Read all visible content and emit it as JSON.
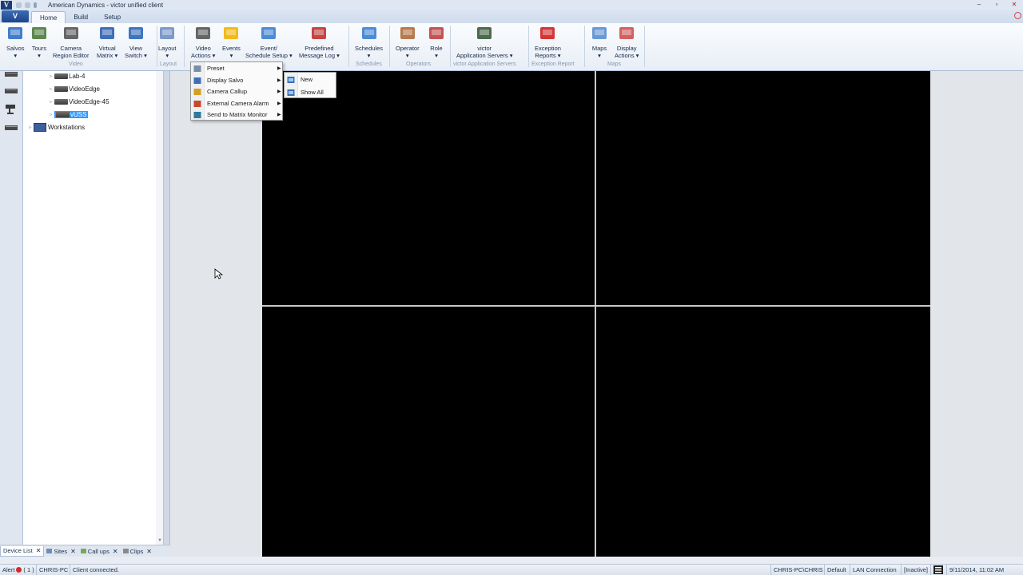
{
  "window": {
    "title": "American Dynamics - victor unified client",
    "logo": "V",
    "controls": [
      "–",
      "▫",
      "✕"
    ]
  },
  "ribbon": {
    "app_menu": "V",
    "tabs": [
      {
        "label": "Home",
        "active": true
      },
      {
        "label": "Build",
        "active": false
      },
      {
        "label": "Setup",
        "active": false
      }
    ],
    "buttons": [
      {
        "id": "salvos",
        "l1": "Salvos",
        "l2": "▾",
        "icon": "salvo-monitor-icon",
        "color": "#2f6fc8"
      },
      {
        "id": "tours",
        "l1": "Tours",
        "l2": "▾",
        "icon": "camera-tour-icon",
        "color": "#4b7a3a"
      },
      {
        "id": "camera-region",
        "l1": "Camera",
        "l2": "Region Editor",
        "icon": "security-camera-icon",
        "color": "#555555"
      },
      {
        "id": "virtual-matrix",
        "l1": "Virtual",
        "l2": "Matrix ▾",
        "icon": "virtual-matrix-icon",
        "color": "#2b5fb0"
      },
      {
        "id": "view-switch",
        "l1": "View",
        "l2": "Switch ▾",
        "icon": "view-switch-icon",
        "color": "#2a66b8"
      },
      {
        "id": "layout",
        "l1": "Layout",
        "l2": "▾",
        "icon": "layout-grid-icon",
        "color": "#6f8fc4"
      },
      {
        "id": "video-actions",
        "l1": "Video",
        "l2": "Actions ▾",
        "icon": "video-clapper-icon",
        "color": "#555555"
      },
      {
        "id": "events",
        "l1": "Events",
        "l2": "▾",
        "icon": "lightning-icon",
        "color": "#f2b400"
      },
      {
        "id": "event-schedule",
        "l1": "Event/",
        "l2": "Schedule Setup ▾",
        "icon": "gear-schedule-icon",
        "color": "#3a7fd1"
      },
      {
        "id": "predefined-message",
        "l1": "Predefined",
        "l2": "Message Log ▾",
        "icon": "message-log-icon",
        "color": "#c03030"
      },
      {
        "id": "schedules",
        "l1": "Schedules",
        "l2": "▾",
        "icon": "calendar-clock-icon",
        "color": "#3a7fd1"
      },
      {
        "id": "operator",
        "l1": "Operator",
        "l2": "▾",
        "icon": "operator-user-icon",
        "color": "#b06a3a"
      },
      {
        "id": "role",
        "l1": "Role",
        "l2": "▾",
        "icon": "role-users-icon",
        "color": "#c04040"
      },
      {
        "id": "app-servers",
        "l1": "victor",
        "l2": "Application Servers ▾",
        "icon": "server-network-icon",
        "color": "#3a5a3a"
      },
      {
        "id": "exception-reports",
        "l1": "Exception",
        "l2": "Reports ▾",
        "icon": "exception-report-icon",
        "color": "#d02020"
      },
      {
        "id": "maps",
        "l1": "Maps",
        "l2": "▾",
        "icon": "map-icon",
        "color": "#5a8fd0"
      },
      {
        "id": "display-actions",
        "l1": "Display",
        "l2": "Actions ▾",
        "icon": "display-actions-icon",
        "color": "#d05050"
      }
    ],
    "groups": [
      "Video",
      "Layout",
      "Schedules",
      "Operators",
      "victor Application Servers",
      "Exception Report",
      "Maps"
    ]
  },
  "device_tree": {
    "nodes": [
      {
        "label": "Lab-4",
        "type": "device"
      },
      {
        "label": "VideoEdge",
        "type": "device"
      },
      {
        "label": "VideoEdge-45",
        "type": "device"
      },
      {
        "label": "vUSS",
        "type": "device",
        "selected": true
      },
      {
        "label": "Workstations",
        "type": "workstation"
      }
    ]
  },
  "video_actions_menu": {
    "items": [
      {
        "label": "Preset",
        "has_submenu": true,
        "icon": "preset-camera-icon"
      },
      {
        "label": "Display Salvo",
        "has_submenu": true,
        "icon": "display-salvo-icon"
      },
      {
        "label": "Camera Callup",
        "has_submenu": true,
        "icon": "camera-callup-icon"
      },
      {
        "label": "External Camera Alarm",
        "has_submenu": true,
        "icon": "camera-alarm-icon"
      },
      {
        "label": "Send to Matrix Monitor",
        "has_submenu": true,
        "icon": "matrix-monitor-icon"
      }
    ],
    "submenu": [
      {
        "label": "New",
        "icon": "salvo-new-icon"
      },
      {
        "label": "Show All",
        "icon": "salvo-show-all-icon"
      }
    ]
  },
  "bottom_tabs": [
    {
      "label": "Device List",
      "active": true
    },
    {
      "label": "Sites",
      "active": false
    },
    {
      "label": "Call ups",
      "active": false
    },
    {
      "label": "Clips",
      "active": false
    }
  ],
  "status_bar": {
    "alert_label": "Alert",
    "alert_count": "( 1 )",
    "machine": "CHRIS-PC",
    "connection_status": "Client connected.",
    "user": "CHRIS-PC\\CHRIS",
    "profile": "Default",
    "network": "LAN Connection",
    "state": "[Inactive]",
    "datetime": "9/11/2014, 11:02 AM"
  }
}
